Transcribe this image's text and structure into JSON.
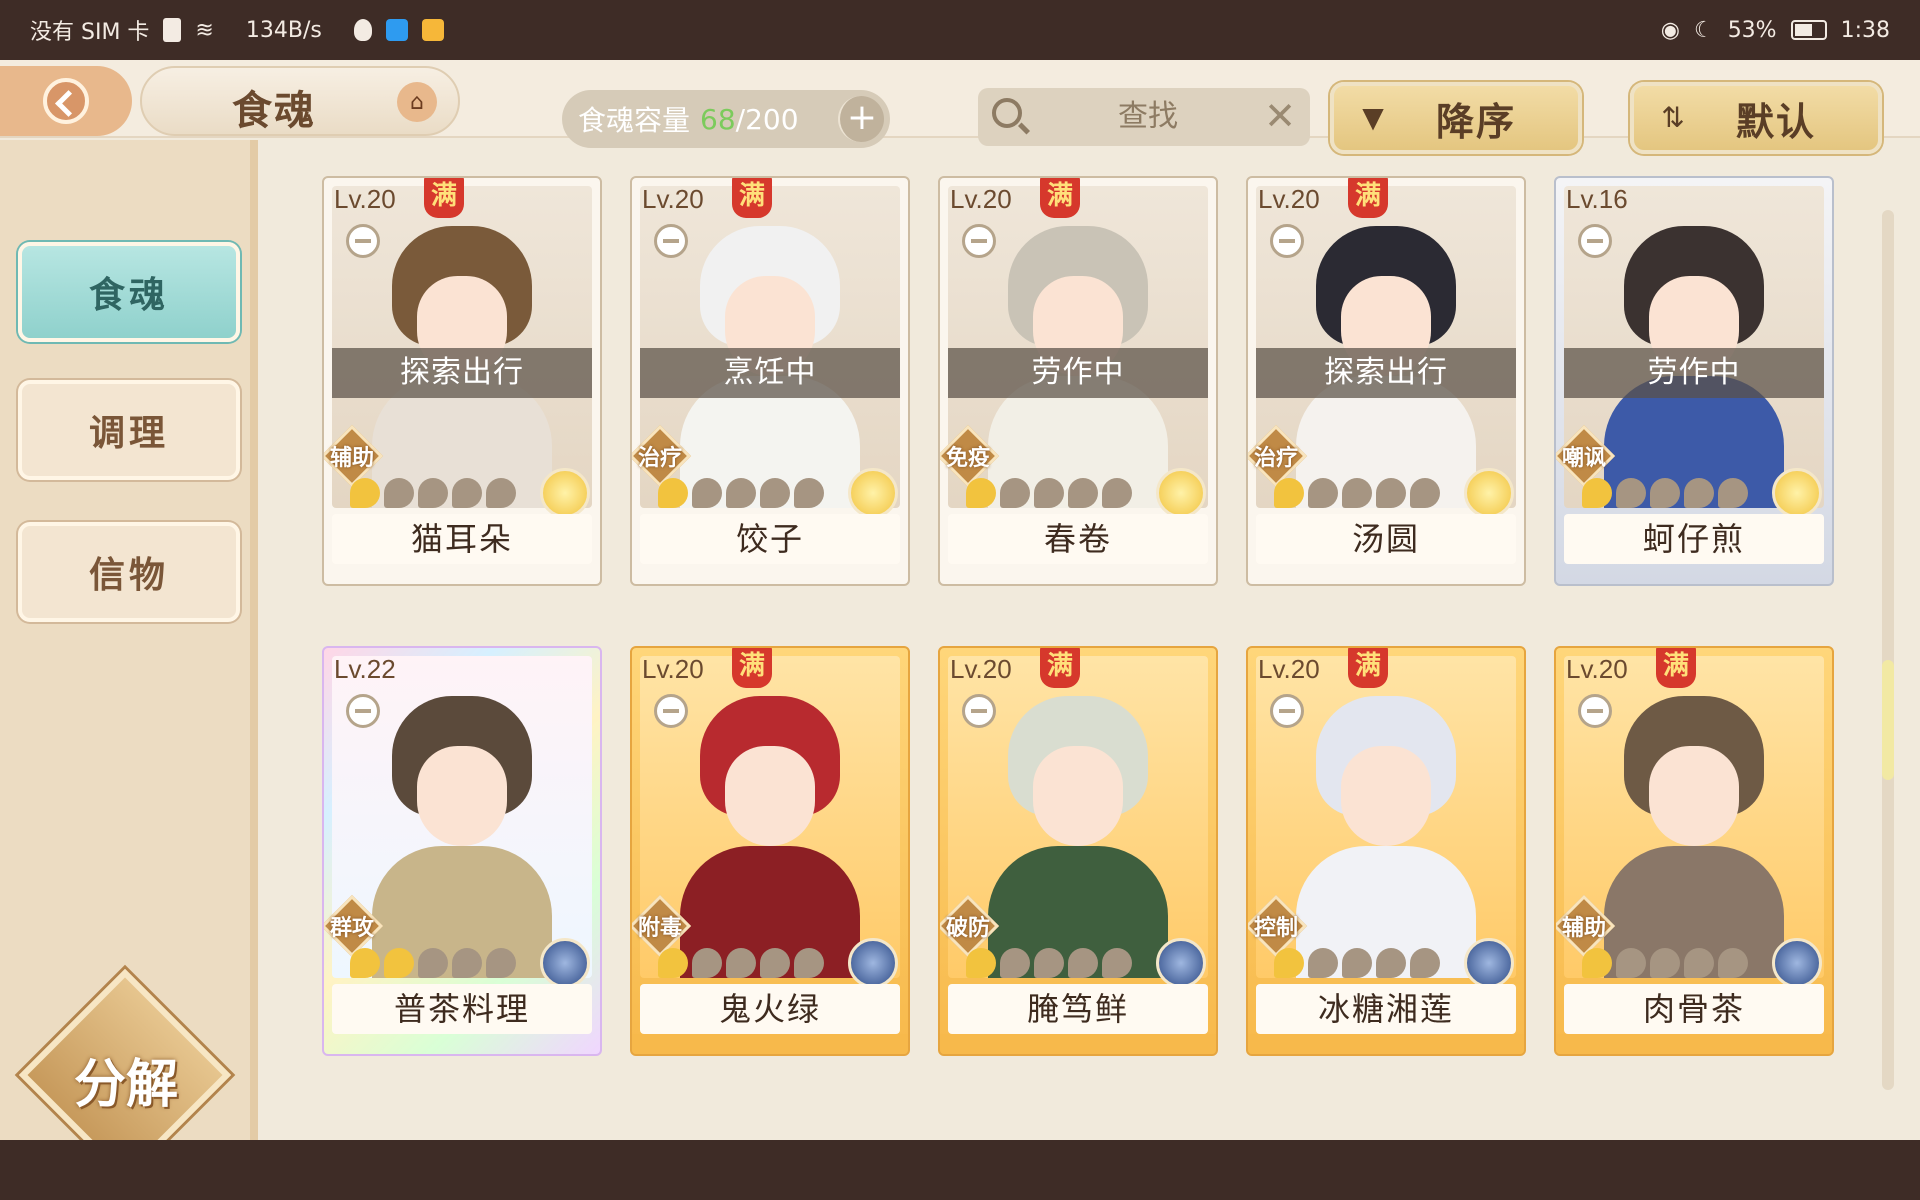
{
  "status_bar": {
    "carrier": "没有 SIM 卡",
    "speed": "134B/s",
    "battery_pct": "53%",
    "time": "1:38"
  },
  "header": {
    "title": "食魂",
    "capacity_label": "食魂容量",
    "capacity_current": "68",
    "capacity_max": "/200",
    "search_placeholder": "查找",
    "sort_label": "降序",
    "default_label": "默认"
  },
  "sidebar": {
    "tabs": [
      {
        "label": "食魂",
        "active": true
      },
      {
        "label": "调理",
        "active": false
      },
      {
        "label": "信物",
        "active": false
      }
    ],
    "decompose_label": "分解"
  },
  "cards": [
    {
      "level": "Lv.20",
      "full": "满",
      "status": "探索出行",
      "role": "辅助",
      "stars": 1,
      "name": "猫耳朵",
      "frame": "plain",
      "element": "yellow",
      "hair": "#7a5a3a",
      "outfit": "#e8e0d6"
    },
    {
      "level": "Lv.20",
      "full": "满",
      "status": "烹饪中",
      "role": "治疗",
      "stars": 1,
      "name": "饺子",
      "frame": "plain",
      "element": "yellow",
      "hair": "#f1f1f1",
      "outfit": "#f4f4f0"
    },
    {
      "level": "Lv.20",
      "full": "满",
      "status": "劳作中",
      "role": "免疫",
      "stars": 1,
      "name": "春卷",
      "frame": "plain",
      "element": "yellow",
      "hair": "#c9c3b6",
      "outfit": "#f2efe6"
    },
    {
      "level": "Lv.20",
      "full": "满",
      "status": "探索出行",
      "role": "治疗",
      "stars": 1,
      "name": "汤圆",
      "frame": "plain",
      "element": "yellow",
      "hair": "#2b2a33",
      "outfit": "#f5f2ee"
    },
    {
      "level": "Lv.16",
      "full": "",
      "status": "劳作中",
      "role": "嘲讽",
      "stars": 1,
      "name": "蚵仔煎",
      "frame": "silver",
      "element": "yellow",
      "hair": "#3b3230",
      "outfit": "#3d5aa8"
    },
    {
      "level": "Lv.22",
      "full": "",
      "status": "",
      "role": "群攻",
      "stars": 2,
      "name": "普茶料理",
      "frame": "rainbow",
      "element": "blue",
      "hair": "#5b4a3b",
      "outfit": "#c8b58a"
    },
    {
      "level": "Lv.20",
      "full": "满",
      "status": "",
      "role": "附毒",
      "stars": 1,
      "name": "鬼火绿",
      "frame": "gold",
      "element": "blue",
      "hair": "#b82a2f",
      "outfit": "#8c1f24"
    },
    {
      "level": "Lv.20",
      "full": "满",
      "status": "",
      "role": "破防",
      "stars": 1,
      "name": "腌笃鲜",
      "frame": "gold",
      "element": "blue",
      "hair": "#d9ddd0",
      "outfit": "#3f5f3e"
    },
    {
      "level": "Lv.20",
      "full": "满",
      "status": "",
      "role": "控制",
      "stars": 1,
      "name": "冰糖湘莲",
      "frame": "gold",
      "element": "blue",
      "hair": "#e3e6ef",
      "outfit": "#f1f2f6"
    },
    {
      "level": "Lv.20",
      "full": "满",
      "status": "",
      "role": "辅助",
      "stars": 1,
      "name": "肉骨茶",
      "frame": "gold",
      "element": "blue",
      "hair": "#6e5a45",
      "outfit": "#8a7768"
    }
  ]
}
